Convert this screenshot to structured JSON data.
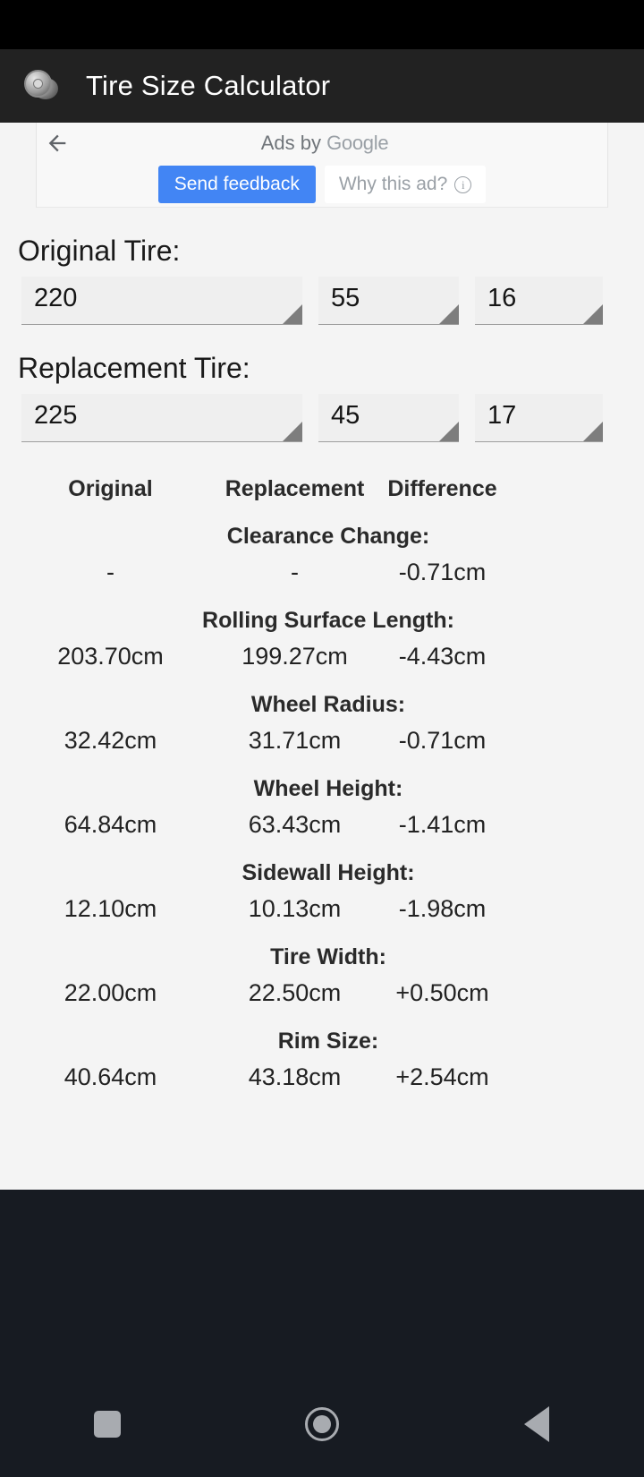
{
  "app": {
    "title": "Tire Size Calculator",
    "icon": "wheel-rim-icon"
  },
  "ad": {
    "back_icon": "back-arrow-icon",
    "ads_by_prefix": "Ads by ",
    "google_wordmark": "Google",
    "send_feedback_label": "Send feedback",
    "why_this_ad_label": "Why this ad?",
    "info_glyph": "i",
    "accent_blue": "#4285f4"
  },
  "original": {
    "label": "Original Tire:",
    "width": "220",
    "aspect": "55",
    "rim": "16"
  },
  "replacement": {
    "label": "Replacement Tire:",
    "width": "225",
    "aspect": "45",
    "rim": "17"
  },
  "results": {
    "columns": [
      "Original",
      "Replacement",
      "Difference"
    ],
    "rows": [
      {
        "title": "Clearance Change:",
        "original": "-",
        "replacement": "-",
        "difference": "-0.71cm"
      },
      {
        "title": "Rolling Surface Length:",
        "original": "203.70cm",
        "replacement": "199.27cm",
        "difference": "-4.43cm"
      },
      {
        "title": "Wheel Radius:",
        "original": "32.42cm",
        "replacement": "31.71cm",
        "difference": "-0.71cm"
      },
      {
        "title": "Wheel Height:",
        "original": "64.84cm",
        "replacement": "63.43cm",
        "difference": "-1.41cm"
      },
      {
        "title": "Sidewall Height:",
        "original": "12.10cm",
        "replacement": "10.13cm",
        "difference": "-1.98cm"
      },
      {
        "title": "Tire Width:",
        "original": "22.00cm",
        "replacement": "22.50cm",
        "difference": "+0.50cm"
      },
      {
        "title": "Rim Size:",
        "original": "40.64cm",
        "replacement": "43.18cm",
        "difference": "+2.54cm"
      }
    ]
  },
  "navbar": {
    "recents_icon": "square-recents-icon",
    "home_icon": "circle-home-icon",
    "back_icon": "triangle-back-icon"
  }
}
